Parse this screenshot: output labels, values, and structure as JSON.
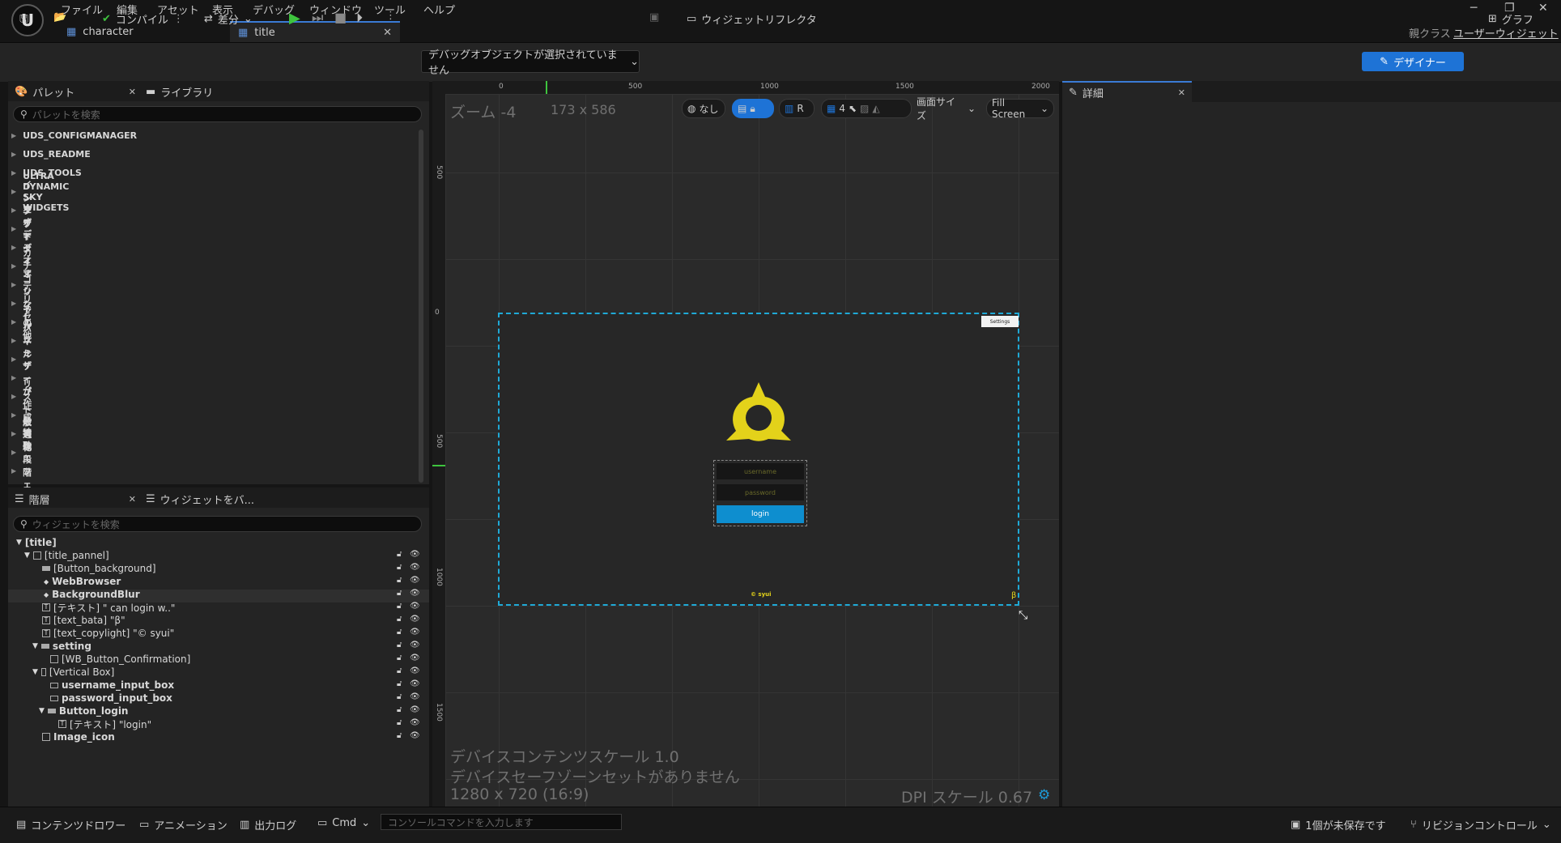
{
  "menu": [
    "ファイル",
    "編集",
    "アセット",
    "表示",
    "デバッグ",
    "ウィンドウ",
    "ツール",
    "ヘルプ"
  ],
  "logo": "U",
  "tabs": [
    {
      "label": "character"
    },
    {
      "label": "title"
    }
  ],
  "parent_class": {
    "label": "親クラス",
    "value": "ユーザーウィジェット"
  },
  "toolbar": {
    "compile": "コンパイル",
    "diff": "差分",
    "debug_object": "デバッグオブジェクトが選択されていません",
    "widget_reflector": "ウィジェットリフレクタ",
    "designer": "デザイナー",
    "graph": "グラフ"
  },
  "palette": {
    "tab": "パレット",
    "library_tab": "ライブラリ",
    "search_placeholder": "パレットを検索",
    "categories": [
      "UDS_CONFIGMANAGER",
      "UDS_README",
      "UDS_TOOLS",
      "ULTRA DYNAMIC SKY WIDGETS",
      "インプット",
      "エディタ",
      "オーディオ",
      "オーディオマテリアル",
      "カテゴリなし",
      "シンセ",
      "その他",
      "パネル",
      "プリミティブ",
      "ユーザーが作成",
      "リスト",
      "一般",
      "最適化",
      "実験段階",
      "特殊エフェクト"
    ]
  },
  "hierarchy": {
    "tab": "階層",
    "widget_tab": "ウィジェットをバ...",
    "search_placeholder": "ウィジェットを検索",
    "items": [
      {
        "label": "[title]",
        "bold": true
      },
      {
        "label": "[title_pannel]",
        "bold": false
      },
      {
        "label": "[Button_background]",
        "bold": false
      },
      {
        "label": "WebBrowser",
        "bold": true
      },
      {
        "label": "BackgroundBlur",
        "bold": true
      },
      {
        "label": "[テキスト] \" can login w..\"",
        "bold": false
      },
      {
        "label": "[text_bata] \"β\"",
        "bold": false
      },
      {
        "label": "[text_copylight] \"© syui\"",
        "bold": false
      },
      {
        "label": "setting",
        "bold": true
      },
      {
        "label": "[WB_Button_Confirmation]",
        "bold": false
      },
      {
        "label": "[Vertical Box]",
        "bold": false
      },
      {
        "label": "username_input_box",
        "bold": true
      },
      {
        "label": "password_input_box",
        "bold": true
      },
      {
        "label": "Button_login",
        "bold": true
      },
      {
        "label": "[テキスト] \"login\"",
        "bold": false
      },
      {
        "label": "Image_icon",
        "bold": true
      }
    ]
  },
  "canvas": {
    "zoom": "ズーム -4",
    "size": "173 x 586",
    "none_label": "なし",
    "r_label": "R",
    "grid_value": "4",
    "screen_size": "画面サイズ",
    "fill_screen": "Fill Screen",
    "ruler_top": [
      "0",
      "500",
      "1000",
      "1500",
      "2000"
    ],
    "ruler_left": [
      "500",
      "0",
      "500",
      "1000",
      "1500"
    ],
    "info_line1": "デバイスコンテンツスケール 1.0",
    "info_line2": "デバイスセーフゾーンセットがありません",
    "info_line3": "1280 x 720 (16:9)",
    "dpi": "DPI スケール 0.67"
  },
  "widget_preview": {
    "settings_button": "Settings",
    "username_placeholder": "username",
    "password_placeholder": "password",
    "login": "login",
    "copyright": "© syui",
    "beta": "β",
    "icon_color": "#e3d21a",
    "button_color": "#0e8ecf"
  },
  "details": {
    "tab": "詳細"
  },
  "statusbar": {
    "content_drawer": "コンテンツドロワー",
    "animation": "アニメーション",
    "output_log": "出力ログ",
    "cmd": "Cmd",
    "console_placeholder": "コンソールコマンドを入力します",
    "unsaved": "1個が未保存です",
    "revision": "リビジョンコントロール"
  },
  "colors": {
    "accent": "#1e73d6",
    "selection": "#1fa9d6",
    "play": "#3ec43e"
  }
}
